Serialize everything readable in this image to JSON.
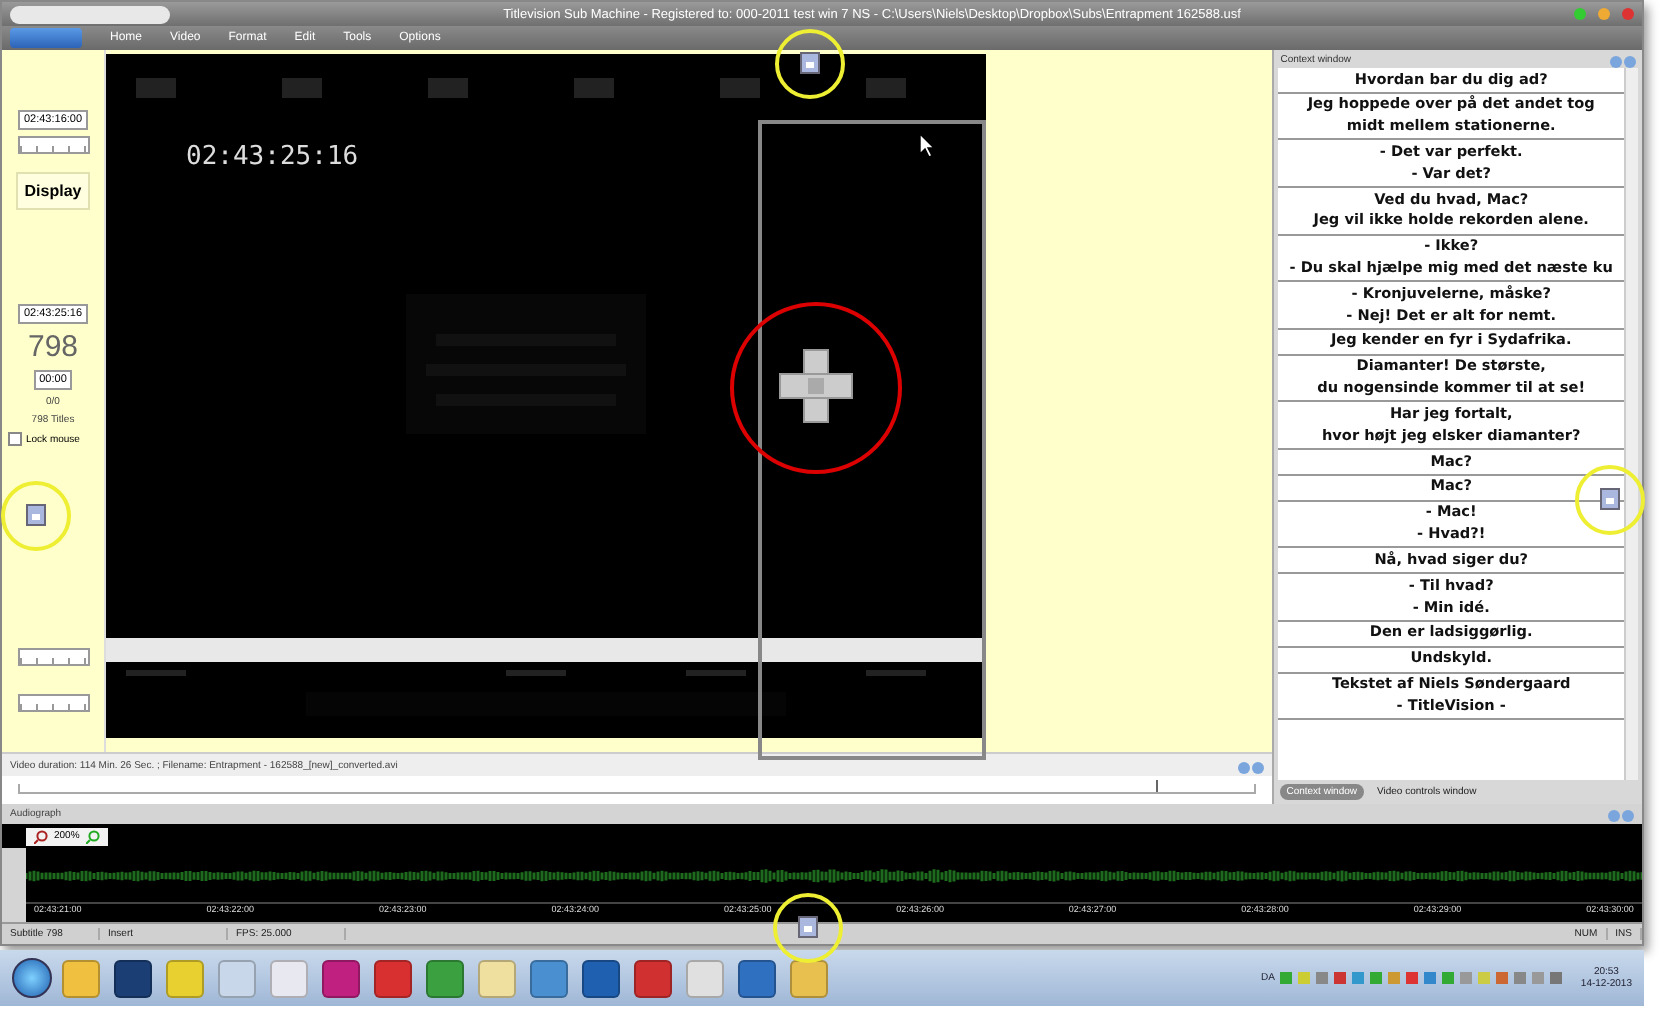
{
  "window": {
    "title": "Titlevision Sub Machine - Registered to: 000-2011 test win 7 NS - C:\\Users\\Niels\\Desktop\\Dropbox\\Subs\\Entrapment 162588.usf"
  },
  "menu": [
    "Home",
    "Video",
    "Format",
    "Edit",
    "Tools",
    "Options"
  ],
  "left_panel": {
    "start_time": "02:43:16:00",
    "display_button": "Display",
    "current_time": "02:43:25:16",
    "subtitle_number": "798",
    "duration": "00:00",
    "progress": "0/0",
    "titles_count": "798 Titles",
    "lock_mouse": {
      "label": "Lock mouse",
      "checked": false
    }
  },
  "video": {
    "timecode": "02:43:25:16"
  },
  "video_info": "Video duration: 114 Min. 26 Sec. ; Filename: Entrapment - 162588_[new]_converted.avi",
  "position_slider": {
    "level": 0.92
  },
  "context_window": {
    "title": "Context window",
    "subtitles": [
      [
        "Hvordan bar du dig ad?"
      ],
      [
        "Jeg hoppede over på det andet tog",
        "midt mellem stationerne."
      ],
      [
        "- Det var perfekt.",
        "- Var det?"
      ],
      [
        "Ved du hvad, Mac?",
        "Jeg vil ikke holde rekorden alene."
      ],
      [
        "- Ikke?",
        "- Du skal hjælpe mig med det næste ku"
      ],
      [
        "- Kronjuvelerne, måske?",
        "- Nej! Det er alt for nemt."
      ],
      [
        "Jeg kender en fyr i Sydafrika."
      ],
      [
        "Diamanter! De største,",
        "du nogensinde kommer til at se!"
      ],
      [
        "Har jeg fortalt,",
        "hvor højt jeg elsker diamanter?"
      ],
      [
        "Mac?"
      ],
      [
        "Mac?"
      ],
      [
        "- Mac!",
        "- Hvad?!"
      ],
      [
        "Nå, hvad siger du?"
      ],
      [
        "- Til hvad?",
        "- Min idé."
      ],
      [
        "Den er ladsiggørlig."
      ],
      [
        "Undskyld."
      ],
      [
        "Tekstet af Niels Søndergaard",
        "- TitleVision -"
      ]
    ],
    "tabs": [
      {
        "label": "Context window",
        "selected": true
      },
      {
        "label": "Video controls window",
        "selected": false
      }
    ]
  },
  "audiograph": {
    "title": "Audiograph",
    "zoom": "200%",
    "times": [
      "02:43:21:00",
      "02:43:22:00",
      "02:43:23:00",
      "02:43:24:00",
      "02:43:25:00",
      "02:43:26:00",
      "02:43:27:00",
      "02:43:28:00",
      "02:43:29:00",
      "02:43:30:00"
    ]
  },
  "status_bar": [
    "Subtitle 798",
    "Insert",
    "FPS: 25.000",
    "NUM",
    "INS"
  ],
  "taskbar": {
    "keyboard_layout": "DA",
    "time": "20:53",
    "date": "14-12-2013"
  }
}
